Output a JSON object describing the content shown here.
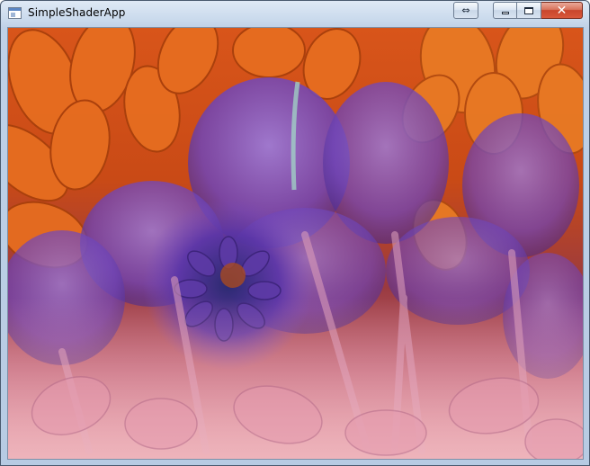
{
  "window": {
    "title": "SimpleShaderApp",
    "controls": {
      "extra_icon": "swap-arrows-icon",
      "minimize_icon": "minimize-icon",
      "maximize_icon": "maximize-icon",
      "close_icon": "close-icon"
    }
  },
  "viewport": {
    "content": "shader-rendered blended flower image",
    "colors": {
      "orange_petals": "#e0621a",
      "deep_orange": "#b8420c",
      "purple_tulips": "#7a4fc0",
      "deep_purple": "#4a2a8a",
      "pink_base": "#d98aa0"
    }
  }
}
